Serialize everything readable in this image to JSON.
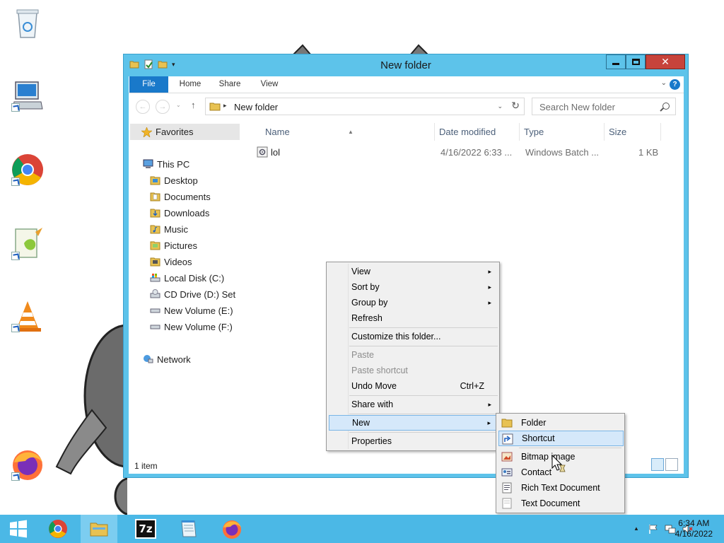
{
  "window": {
    "title": "New folder",
    "close_glyph": "✕"
  },
  "ribbon": {
    "tabs": [
      "File",
      "Home",
      "Share",
      "View"
    ],
    "chevron": "⌄",
    "help": "?"
  },
  "address": {
    "separator": "▸",
    "path": "New folder",
    "dropdown": "⌄",
    "refresh": "↻"
  },
  "search": {
    "placeholder": "Search New folder"
  },
  "navigation": {
    "back": "←",
    "forward": "→",
    "up": "↑",
    "history": "⌄"
  },
  "nav_pane": {
    "favorites": "Favorites",
    "this_pc": "This PC",
    "items": [
      "Desktop",
      "Documents",
      "Downloads",
      "Music",
      "Pictures",
      "Videos",
      "Local Disk (C:)",
      "CD Drive (D:) Set",
      "New Volume (E:)",
      "New Volume (F:)"
    ],
    "network": "Network"
  },
  "columns": [
    "Name",
    "Date modified",
    "Type",
    "Size"
  ],
  "files": [
    {
      "name": "lol",
      "date": "4/16/2022 6:33 ...",
      "type": "Windows Batch ...",
      "size": "1 KB",
      "icon": "batch-file-icon"
    }
  ],
  "status": {
    "count": "1 item"
  },
  "context_menu": {
    "items": [
      {
        "label": "View",
        "submenu": true
      },
      {
        "label": "Sort by",
        "submenu": true
      },
      {
        "label": "Group by",
        "submenu": true
      },
      {
        "label": "Refresh"
      },
      {
        "label": "Customize this folder..."
      },
      {
        "label": "Paste",
        "disabled": true
      },
      {
        "label": "Paste shortcut",
        "disabled": true
      },
      {
        "label": "Undo Move",
        "accel": "Ctrl+Z"
      },
      {
        "label": "Share with",
        "submenu": true
      },
      {
        "label": "New",
        "submenu": true,
        "highlighted": true
      },
      {
        "label": "Properties"
      }
    ],
    "submenu_arrow": "▸"
  },
  "new_submenu": {
    "items": [
      {
        "label": "Folder",
        "icon": "folder-icon"
      },
      {
        "label": "Shortcut",
        "icon": "shortcut-icon",
        "highlighted": true
      },
      {
        "label": "Bitmap image",
        "icon": "bitmap-icon"
      },
      {
        "label": "Contact",
        "icon": "contact-icon"
      },
      {
        "label": "Rich Text Document",
        "icon": "rich-text-icon"
      },
      {
        "label": "Text Document",
        "icon": "text-document-icon"
      }
    ]
  },
  "taskbar": {
    "apps": [
      "chrome-icon",
      "file-explorer-icon",
      "7zip-icon",
      "notepad-icon",
      "firefox-icon"
    ],
    "seven_zip_label": "7z",
    "tray_expand": "▲",
    "time": "6:34 AM",
    "date": "4/16/2022"
  },
  "desktop_icons": [
    "recycle-bin-icon",
    "computer-icon",
    "chrome-icon",
    "notepad-plus-plus-icon",
    "vlc-icon",
    "firefox-icon"
  ],
  "colors": {
    "window_frame": "#5dc3ea",
    "file_tab": "#1979ca",
    "close_button": "#c7433b",
    "taskbar": "#4bb8e6",
    "menu_highlight": "#d5e8fa"
  }
}
